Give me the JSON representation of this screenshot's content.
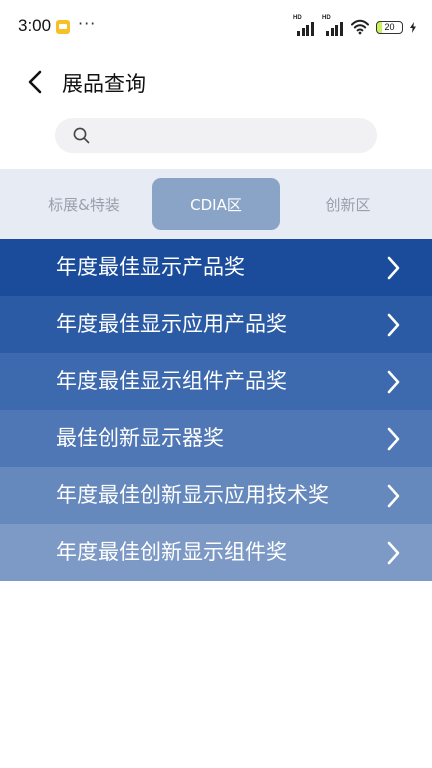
{
  "status_bar": {
    "time": "3:00",
    "more": "···",
    "sim1_label": "HD",
    "sim2_label": "HD",
    "battery_level": "20",
    "battery_fill": 0.2,
    "app_notification_icon": "notes-app-icon",
    "icons": [
      "signal-icon",
      "wifi-icon",
      "battery-icon",
      "charging-bolt-icon"
    ]
  },
  "header": {
    "back_icon": "chevron-left-icon",
    "title": "展品查询"
  },
  "search": {
    "icon": "search-icon",
    "value": "",
    "placeholder": ""
  },
  "tabs": {
    "items": [
      {
        "label": "标展&特装",
        "selected": false
      },
      {
        "label": "CDIA区",
        "selected": true
      },
      {
        "label": "创新区",
        "selected": false
      }
    ],
    "selected_color": "#8aa4c7"
  },
  "awards": {
    "chevron_icon": "chevron-right-icon",
    "items": [
      {
        "label": "年度最佳显示产品奖",
        "color": "#1b4c9c"
      },
      {
        "label": "年度最佳显示应用产品奖",
        "color": "#2c5ba6"
      },
      {
        "label": "年度最佳显示组件产品奖",
        "color": "#3d69af"
      },
      {
        "label": "最佳创新显示器奖",
        "color": "#5077b5"
      },
      {
        "label": "年度最佳创新显示应用技术奖",
        "color": "#6588bd"
      },
      {
        "label": "年度最佳创新显示组件奖",
        "color": "#7c9ac5"
      }
    ]
  }
}
